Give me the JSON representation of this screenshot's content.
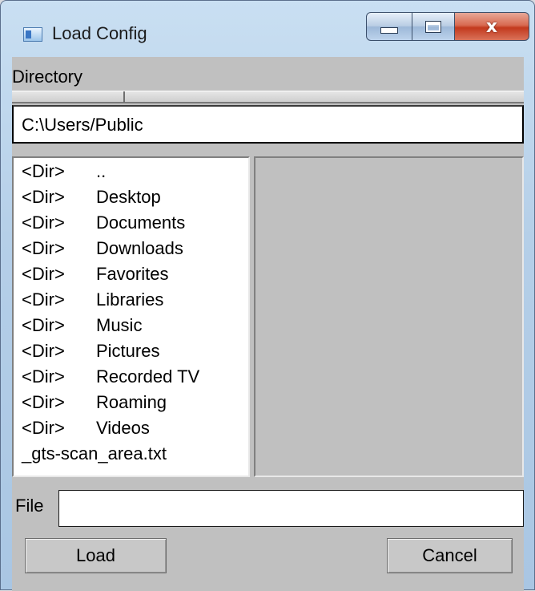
{
  "window": {
    "title": "Load Config",
    "icons": {
      "app": "app-window-icon",
      "minimize": "minimize-icon",
      "maximize": "maximize-icon",
      "close": "close-icon"
    },
    "close_glyph": "x"
  },
  "directory": {
    "label": "Directory",
    "path": "C:\\Users/Public"
  },
  "file_list": {
    "items": [
      {
        "tag": "<Dir>",
        "name": ".."
      },
      {
        "tag": "<Dir>",
        "name": "Desktop"
      },
      {
        "tag": "<Dir>",
        "name": "Documents"
      },
      {
        "tag": "<Dir>",
        "name": "Downloads"
      },
      {
        "tag": "<Dir>",
        "name": "Favorites"
      },
      {
        "tag": "<Dir>",
        "name": "Libraries"
      },
      {
        "tag": "<Dir>",
        "name": "Music"
      },
      {
        "tag": "<Dir>",
        "name": "Pictures"
      },
      {
        "tag": "<Dir>",
        "name": "Recorded TV"
      },
      {
        "tag": "<Dir>",
        "name": "Roaming"
      },
      {
        "tag": "<Dir>",
        "name": "Videos"
      },
      {
        "tag": "",
        "name": "_gts-scan_area.txt"
      }
    ]
  },
  "file": {
    "label": "File",
    "value": ""
  },
  "buttons": {
    "load": "Load",
    "cancel": "Cancel"
  },
  "colors": {
    "dialog_bg": "#c0c0c0",
    "close_button": "#c33a1e",
    "frame": "#b5cfe8"
  }
}
